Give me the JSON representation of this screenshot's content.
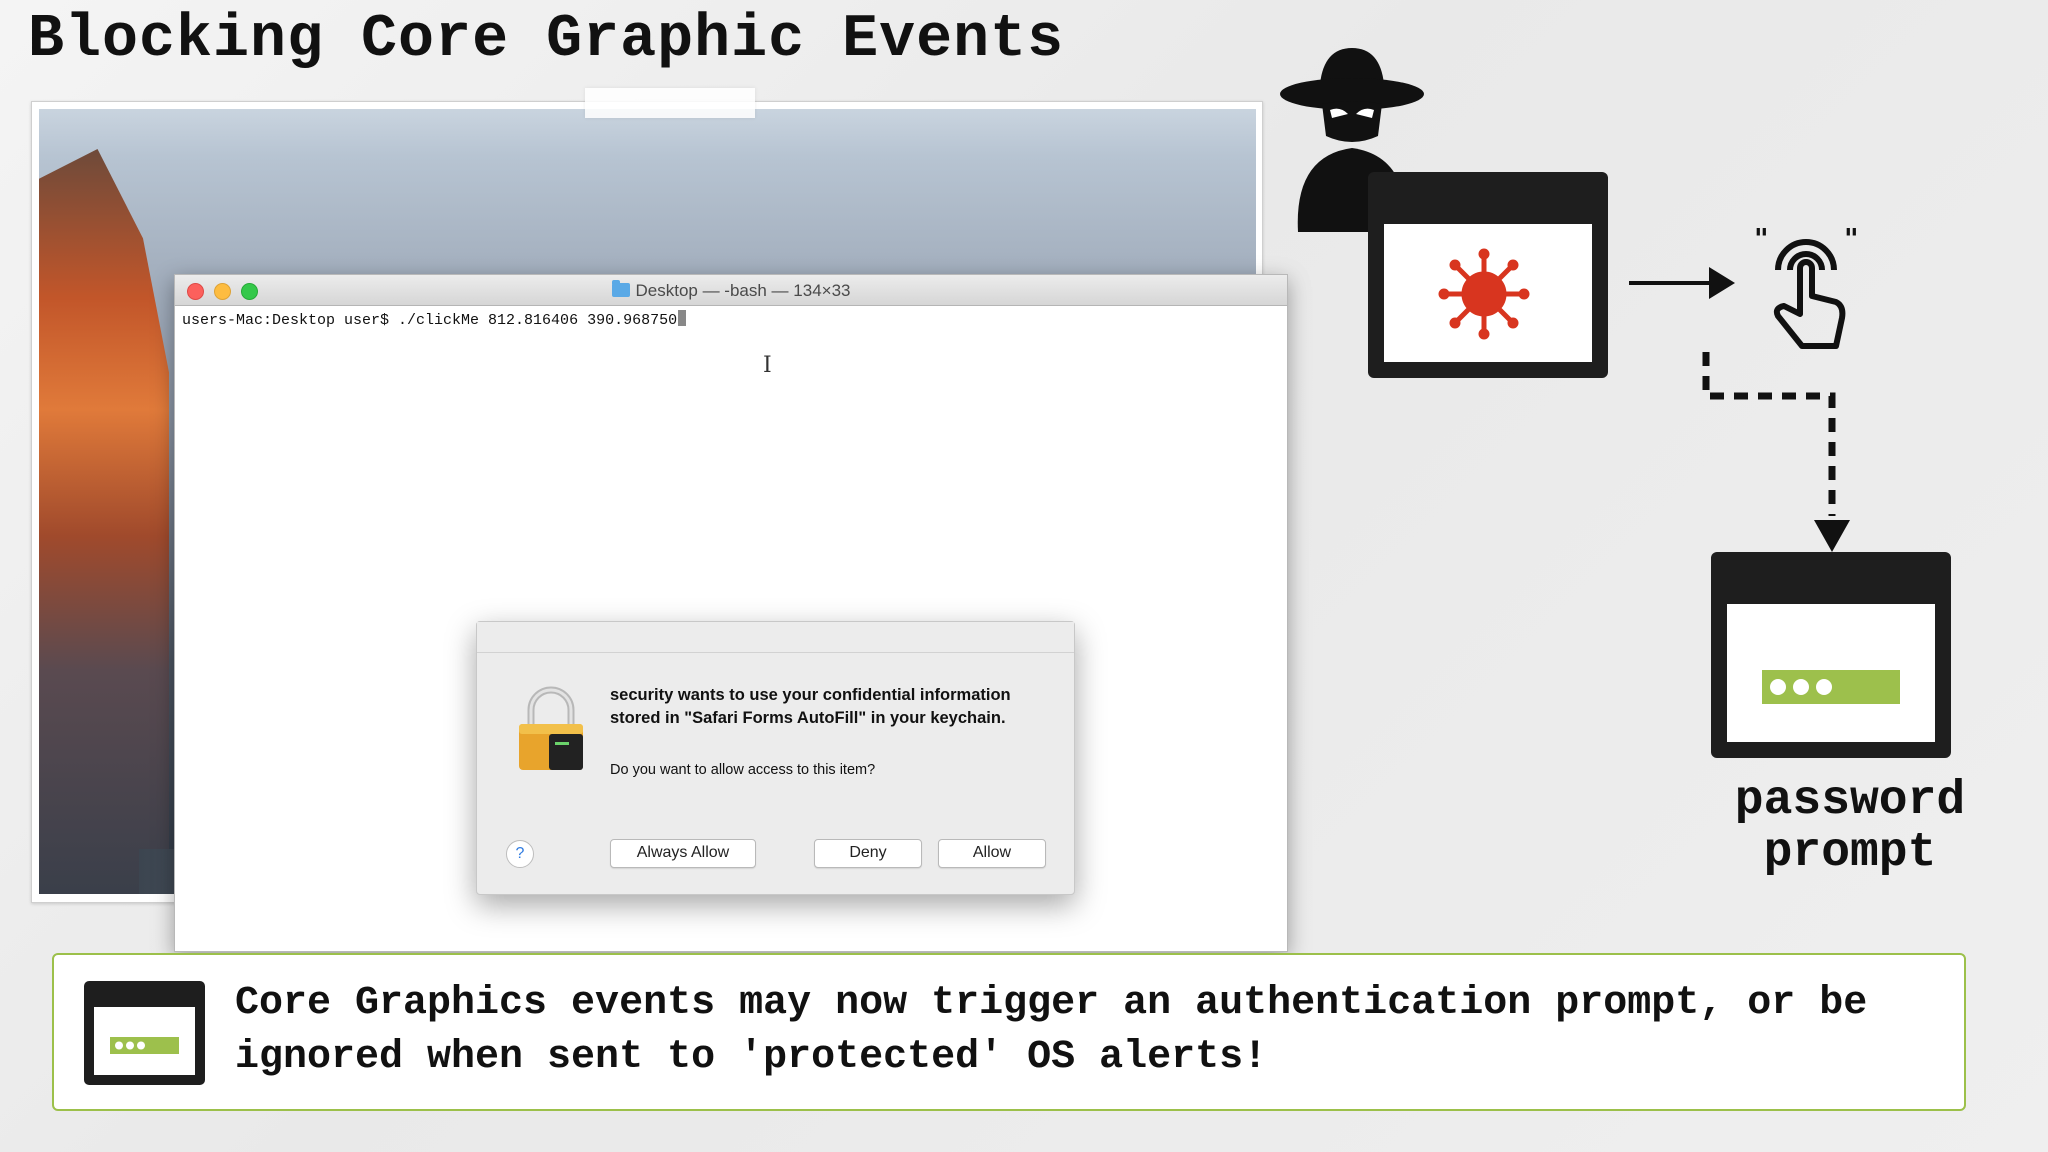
{
  "slide": {
    "title": "Blocking Core Graphic Events"
  },
  "terminal": {
    "title": "Desktop — -bash — 134×33",
    "prompt": "users-Mac:Desktop user$ ./clickMe 812.816406 390.968750"
  },
  "dialog": {
    "message": "security wants to use your confidential information stored in \"Safari Forms AutoFill\" in your keychain.",
    "question": "Do you want to allow access to this item?",
    "help_label": "?",
    "always_allow_label": "Always Allow",
    "deny_label": "Deny",
    "allow_label": "Allow"
  },
  "diagram": {
    "caption": "password prompt",
    "hand_quote": "\"\"",
    "malware_color": "#d8351f",
    "password_field_color": "#9dc04c"
  },
  "callout": {
    "text": "Core Graphics events may now trigger an authentication prompt, or be ignored when sent to 'protected' OS alerts!",
    "border_color": "#9cc04a"
  }
}
